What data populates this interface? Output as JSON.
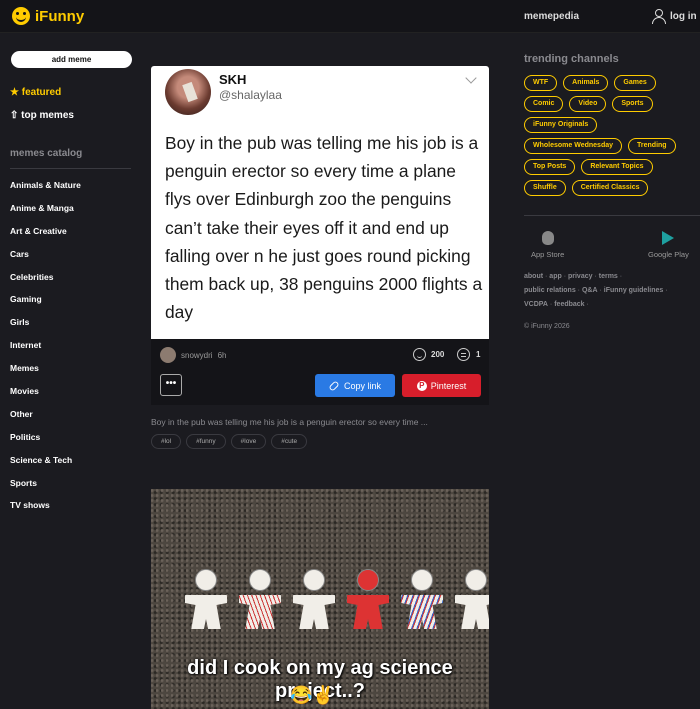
{
  "header": {
    "logo_text": "iFunny",
    "memepedia": "memepedia",
    "login": "log in"
  },
  "sidebar": {
    "add_meme": "add meme",
    "featured": "★ featured",
    "top_memes": "⇧ top memes",
    "catalog_title": "memes catalog",
    "catalog": [
      "Animals & Nature",
      "Anime & Manga",
      "Art & Creative",
      "Cars",
      "Celebrities",
      "Gaming",
      "Girls",
      "Internet",
      "Memes",
      "Movies",
      "Other",
      "Politics",
      "Science & Tech",
      "Sports",
      "TV shows"
    ]
  },
  "post1": {
    "tweet_name": "SKH",
    "tweet_handle": "@shalaylaa",
    "tweet_text": "Boy in the pub was telling me his job is a penguin erector so every time a plane flys over Edinburgh zoo the penguins can’t take their eyes off it and end up falling over n he just goes round picking them back up, 38 penguins 2000 flights a day",
    "author": "snowydri",
    "time": "6h",
    "smiles": "200",
    "comments": "1",
    "more": "•••",
    "copy_link": "Copy link",
    "pinterest": "Pinterest",
    "caption": "Boy in the pub was telling me his job is a penguin erector so every time ...",
    "tags": [
      "#lol",
      "#funny",
      "#love",
      "#cute"
    ]
  },
  "post2": {
    "meme_text": "did I cook on my ag science project..?",
    "meme_emoji": "😂✌️"
  },
  "right": {
    "trending_title": "trending channels",
    "channels": [
      "WTF",
      "Animals",
      "Games",
      "Comic",
      "Video",
      "Sports",
      "iFunny Originals",
      "Wholesome Wednesday",
      "Trending",
      "Top Posts",
      "Relevant Topics",
      "Shuffle",
      "Certified Classics"
    ],
    "app_store": "App Store",
    "google_play": "Google Play",
    "links": {
      "l1": "about",
      "l2": "app",
      "l3": "privacy",
      "l4": "terms",
      "l5": "public relations",
      "l6": "Q&A",
      "l7": "iFunny guidelines",
      "l8": "VCDPA",
      "l9": "feedback"
    },
    "copyright": "© iFunny 2026"
  },
  "colors": {
    "accent": "#ffcc00",
    "background": "#1b1b20",
    "copy_button": "#2a7ae4",
    "pinterest_button": "#d71e2b"
  }
}
